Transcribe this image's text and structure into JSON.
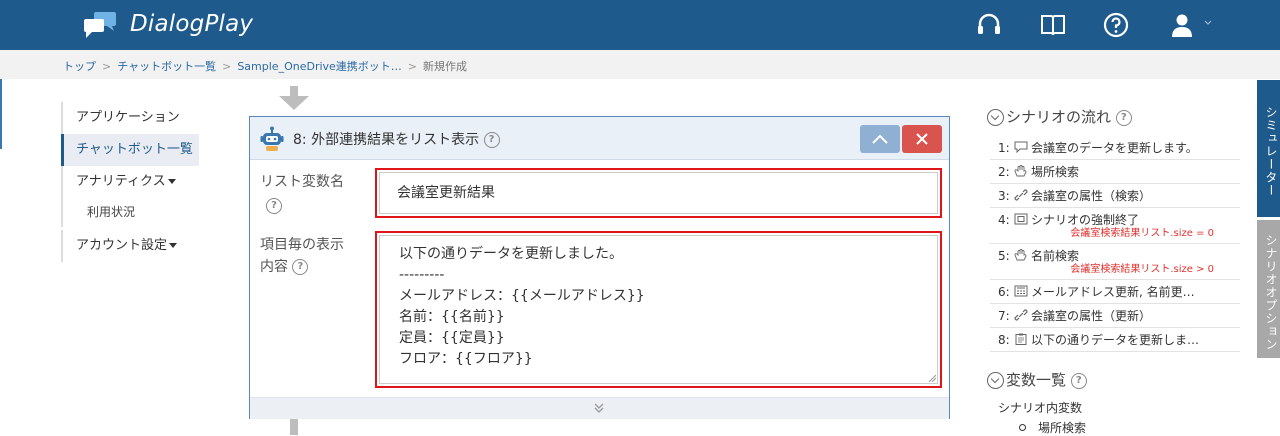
{
  "app": {
    "brand": "DialogPlay"
  },
  "header_icons": [
    "headset-icon",
    "book-icon",
    "help-icon",
    "user-icon"
  ],
  "breadcrumb": {
    "items": [
      "トップ",
      "チャットボット一覧",
      "Sample_OneDrive連携ボット…",
      "新規作成"
    ]
  },
  "nav": {
    "applications": "アプリケーション",
    "chatbots": "チャットボット一覧",
    "analytics": "アナリティクス",
    "usage": "利用状況",
    "account": "アカウント設定"
  },
  "card": {
    "title": "8: 外部連携結果をリスト表示",
    "list_var_label": "リスト変数名",
    "list_var_value": "会議室更新結果",
    "item_label_line1": "項目毎の表示",
    "item_label_line2": "内容",
    "item_template": "以下の通りデータを更新しました。\n---------\nメールアドレス：{{メールアドレス}}\n名前：{{名前}}\n定員：{{定員}}\nフロア：{{フロア}}"
  },
  "flow": {
    "title": "シナリオの流れ",
    "steps": [
      {
        "num": "1:",
        "icon": "speech-bubble-icon",
        "label": "会議室のデータを更新します。"
      },
      {
        "num": "2:",
        "icon": "hand-icon",
        "label": "場所検索"
      },
      {
        "num": "3:",
        "icon": "link-icon",
        "label": "会議室の属性（検索）"
      },
      {
        "num": "4:",
        "icon": "stop-icon",
        "label": "シナリオの強制終了",
        "cond": "会議室検索結果リスト.size = 0"
      },
      {
        "num": "5:",
        "icon": "hand-icon",
        "label": "名前検索",
        "cond": "会議室検索結果リスト.size > 0"
      },
      {
        "num": "6:",
        "icon": "calculator-icon",
        "label": "メールアドレス更新, 名前更…"
      },
      {
        "num": "7:",
        "icon": "link-icon",
        "label": "会議室の属性（更新）"
      },
      {
        "num": "8:",
        "icon": "clipboard-icon",
        "label": "以下の通りデータを更新しま…"
      }
    ]
  },
  "vars": {
    "title": "変数一覧",
    "subtitle": "シナリオ内変数",
    "first_item": "場所検索"
  },
  "side_tabs": {
    "simulator": "シミュレーター",
    "options": "シナリオオプション"
  },
  "colors": {
    "header": "#1e5a8c",
    "accent_red": "#e0151b",
    "close_button": "#d9534f",
    "collapse_button": "#8fb0d2"
  }
}
